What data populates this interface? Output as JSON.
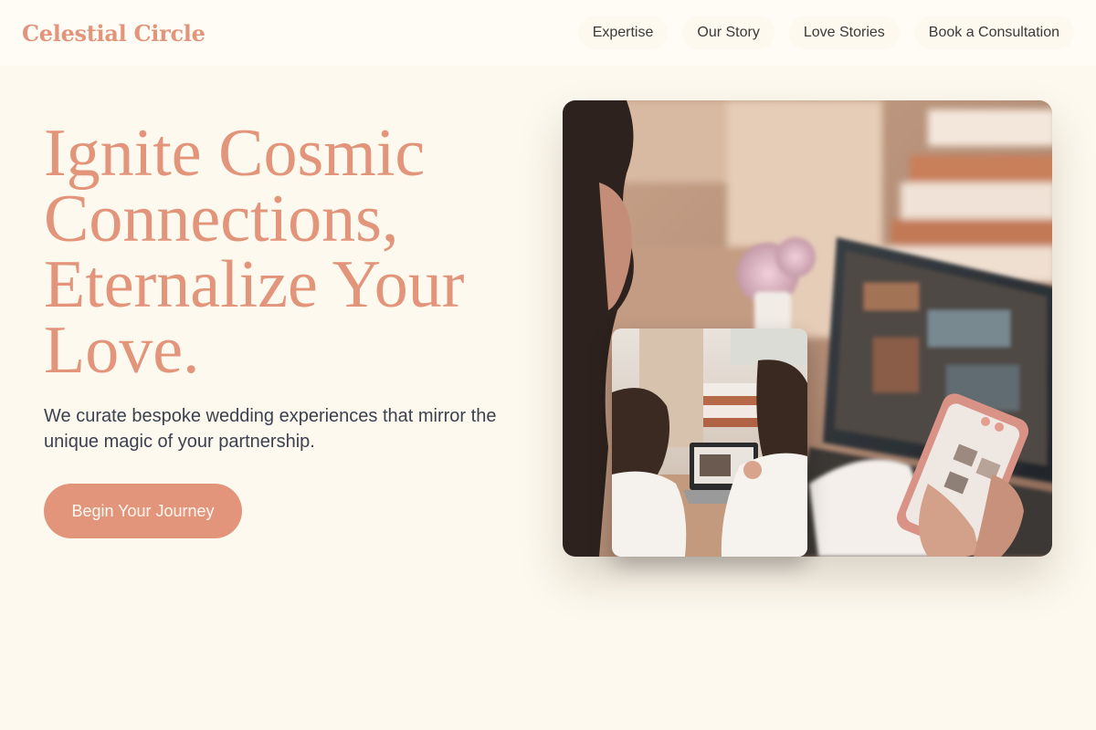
{
  "brand": {
    "name": "Celestial Circle"
  },
  "nav": {
    "items": [
      {
        "label": "Expertise"
      },
      {
        "label": "Our Story"
      },
      {
        "label": "Love Stories"
      },
      {
        "label": "Book a Consultation"
      }
    ]
  },
  "hero": {
    "title": "Ignite Cosmic Connections, Eternalize Your Love.",
    "subtitle": "We curate bespoke wedding experiences that mirror the unique magic of your partnership.",
    "cta_label": "Begin Your Journey"
  },
  "colors": {
    "accent": "#e2957b",
    "background": "#fdf9ee",
    "text": "#3c4150"
  }
}
